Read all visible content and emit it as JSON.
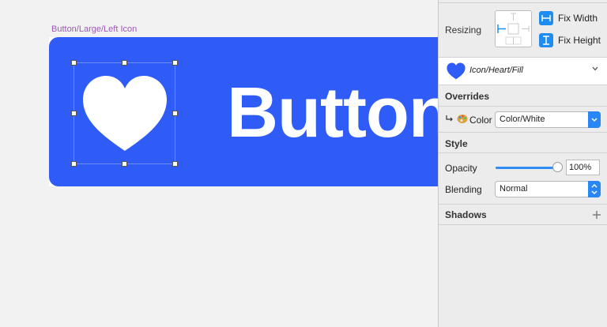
{
  "canvas": {
    "artboard_label": "Button/Large/Left Icon",
    "button_text": "Button",
    "button_color": "#2f5cf7"
  },
  "inspector": {
    "resizing": {
      "label": "Resizing",
      "fix_width": {
        "label": "Fix Width",
        "icon": "fix-width-icon"
      },
      "fix_height": {
        "label": "Fix Height",
        "icon": "fix-height-icon"
      }
    },
    "symbol": {
      "name": "Icon/Heart/Fill",
      "icon": "heart-icon"
    },
    "overrides": {
      "title": "Overrides",
      "color_label": "Color",
      "color_value": "Color/White"
    },
    "style": {
      "title": "Style",
      "opacity_label": "Opacity",
      "opacity_value": "100%",
      "opacity_level": 1.0,
      "blending_label": "Blending",
      "blending_value": "Normal"
    },
    "shadows": {
      "title": "Shadows"
    }
  },
  "colors": {
    "accent": "#1e8cf0",
    "selection": "#6c8cff"
  }
}
